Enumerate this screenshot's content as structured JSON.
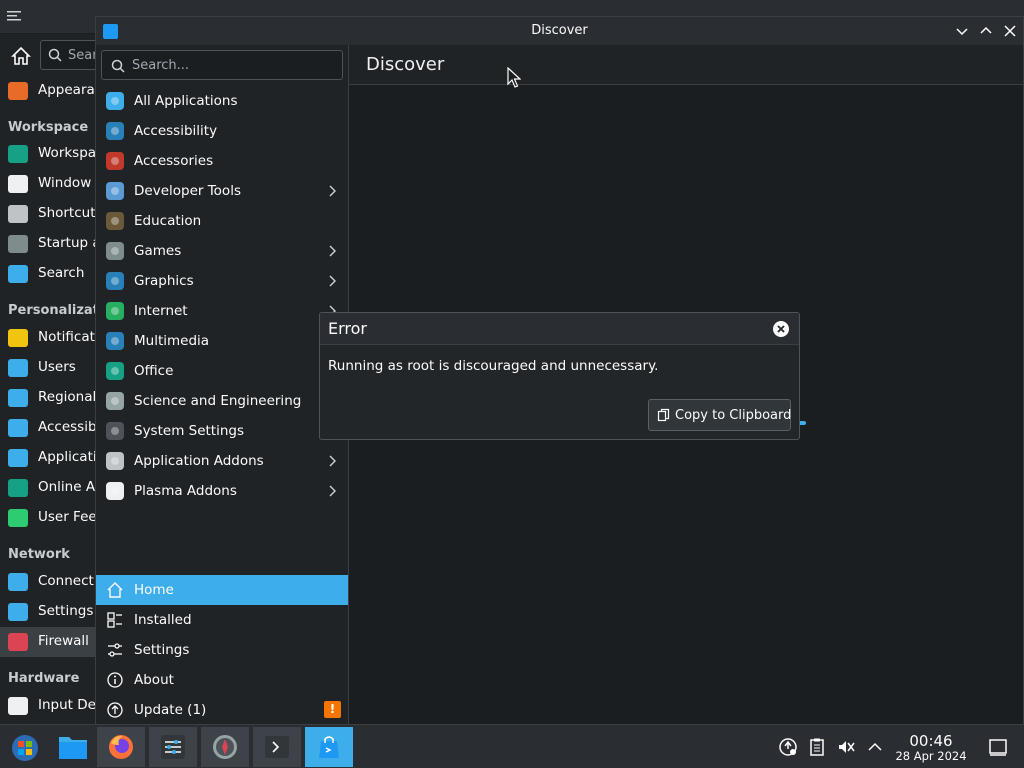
{
  "background_window": {
    "search_placeholder": "Sear",
    "sections": {
      "workspace": "Workspace",
      "personalization": "Personalizatio",
      "network": "Network",
      "hardware": "Hardware"
    },
    "items": [
      {
        "label": "Appearan",
        "color": "#e86b2a"
      },
      {
        "label": "Workspac",
        "color": "#16a085"
      },
      {
        "label": "Window M",
        "color": "#eff0f1"
      },
      {
        "label": "Shortcuts",
        "color": "#bdc3c7"
      },
      {
        "label": "Startup a",
        "color": "#7f8c8d"
      },
      {
        "label": "Search",
        "color": "#3daee9"
      },
      {
        "label": "Notificatio",
        "color": "#f1c40f"
      },
      {
        "label": "Users",
        "color": "#3daee9"
      },
      {
        "label": "Regional",
        "color": "#3daee9"
      },
      {
        "label": "Accessibil",
        "color": "#3daee9"
      },
      {
        "label": "Applicatio",
        "color": "#3daee9"
      },
      {
        "label": "Online Ac",
        "color": "#16a085"
      },
      {
        "label": "User Feed",
        "color": "#2ecc71"
      },
      {
        "label": "Connectio",
        "color": "#3daee9"
      },
      {
        "label": "Settings",
        "color": "#3daee9"
      },
      {
        "label": "Firewall",
        "color": "#da4453"
      },
      {
        "label": "Input Dev",
        "color": "#eff0f1"
      }
    ]
  },
  "discover": {
    "window_title": "Discover",
    "page_title": "Discover",
    "search_placeholder": "Search...",
    "categories": [
      {
        "label": "All Applications",
        "icon": "grid-icon",
        "color": "#3daee9",
        "chevron": false
      },
      {
        "label": "Accessibility",
        "icon": "accessibility-icon",
        "color": "#2980b9",
        "chevron": false
      },
      {
        "label": "Accessories",
        "icon": "toolbox-icon",
        "color": "#c0392b",
        "chevron": false
      },
      {
        "label": "Developer Tools",
        "icon": "hammer-icon",
        "color": "#5b9bd5",
        "chevron": true
      },
      {
        "label": "Education",
        "icon": "chalkboard-icon",
        "color": "#6b5a3a",
        "chevron": false
      },
      {
        "label": "Games",
        "icon": "gamepad-icon",
        "color": "#7f8c8d",
        "chevron": true
      },
      {
        "label": "Graphics",
        "icon": "graphics-icon",
        "color": "#2980b9",
        "chevron": true
      },
      {
        "label": "Internet",
        "icon": "globe-icon",
        "color": "#27ae60",
        "chevron": true
      },
      {
        "label": "Multimedia",
        "icon": "multimedia-icon",
        "color": "#2980b9",
        "chevron": false
      },
      {
        "label": "Office",
        "icon": "office-icon",
        "color": "#16a085",
        "chevron": false
      },
      {
        "label": "Science and Engineering",
        "icon": "flask-icon",
        "color": "#95a5a6",
        "chevron": false
      },
      {
        "label": "System Settings",
        "icon": "system-settings-icon",
        "color": "#4d5358",
        "chevron": false
      },
      {
        "label": "Application Addons",
        "icon": "addons-icon",
        "color": "#bdc3c7",
        "chevron": true
      },
      {
        "label": "Plasma Addons",
        "icon": "plasma-icon",
        "color": "#eff0f1",
        "chevron": true
      }
    ],
    "nav": [
      {
        "label": "Home",
        "icon": "home-icon",
        "active": true
      },
      {
        "label": "Installed",
        "icon": "installed-icon",
        "active": false
      },
      {
        "label": "Settings",
        "icon": "settings-sliders-icon",
        "active": false
      },
      {
        "label": "About",
        "icon": "info-icon",
        "active": false
      },
      {
        "label": "Update (1)",
        "icon": "update-icon",
        "active": false
      }
    ],
    "update_badge": "!"
  },
  "error_dialog": {
    "title": "Error",
    "message": "Running as root is discouraged and unnecessary.",
    "copy_button": "Copy to Clipboard"
  },
  "taskbar": {
    "apps": [
      {
        "name": "start-menu",
        "icon": "start-orb-icon"
      },
      {
        "name": "file-manager",
        "icon": "folder-icon"
      },
      {
        "name": "firefox",
        "icon": "firefox-icon"
      },
      {
        "name": "system-settings",
        "icon": "system-settings-icon"
      },
      {
        "name": "compass",
        "icon": "compass-icon"
      },
      {
        "name": "terminal",
        "icon": "terminal-icon"
      },
      {
        "name": "discover",
        "icon": "discover-icon"
      }
    ],
    "clock_time": "00:46",
    "clock_date": "28 Apr 2024"
  },
  "colors": {
    "accent": "#3daee9",
    "warning": "#f67400",
    "window_bg": "#1b1e20"
  }
}
